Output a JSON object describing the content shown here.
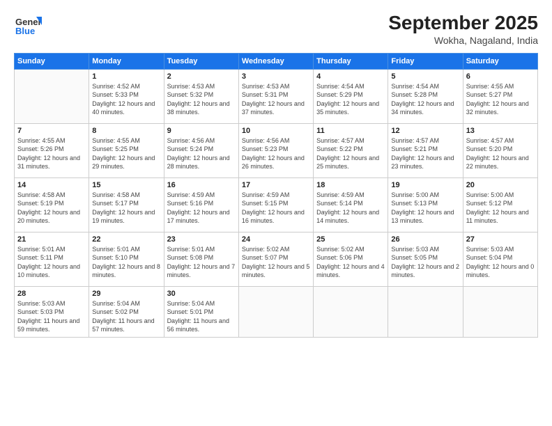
{
  "logo": {
    "line1": "General",
    "line2": "Blue"
  },
  "title": "September 2025",
  "subtitle": "Wokha, Nagaland, India",
  "headers": [
    "Sunday",
    "Monday",
    "Tuesday",
    "Wednesday",
    "Thursday",
    "Friday",
    "Saturday"
  ],
  "weeks": [
    [
      {
        "day": "",
        "sunrise": "",
        "sunset": "",
        "daylight": ""
      },
      {
        "day": "1",
        "sunrise": "Sunrise: 4:52 AM",
        "sunset": "Sunset: 5:33 PM",
        "daylight": "Daylight: 12 hours and 40 minutes."
      },
      {
        "day": "2",
        "sunrise": "Sunrise: 4:53 AM",
        "sunset": "Sunset: 5:32 PM",
        "daylight": "Daylight: 12 hours and 38 minutes."
      },
      {
        "day": "3",
        "sunrise": "Sunrise: 4:53 AM",
        "sunset": "Sunset: 5:31 PM",
        "daylight": "Daylight: 12 hours and 37 minutes."
      },
      {
        "day": "4",
        "sunrise": "Sunrise: 4:54 AM",
        "sunset": "Sunset: 5:29 PM",
        "daylight": "Daylight: 12 hours and 35 minutes."
      },
      {
        "day": "5",
        "sunrise": "Sunrise: 4:54 AM",
        "sunset": "Sunset: 5:28 PM",
        "daylight": "Daylight: 12 hours and 34 minutes."
      },
      {
        "day": "6",
        "sunrise": "Sunrise: 4:55 AM",
        "sunset": "Sunset: 5:27 PM",
        "daylight": "Daylight: 12 hours and 32 minutes."
      }
    ],
    [
      {
        "day": "7",
        "sunrise": "Sunrise: 4:55 AM",
        "sunset": "Sunset: 5:26 PM",
        "daylight": "Daylight: 12 hours and 31 minutes."
      },
      {
        "day": "8",
        "sunrise": "Sunrise: 4:55 AM",
        "sunset": "Sunset: 5:25 PM",
        "daylight": "Daylight: 12 hours and 29 minutes."
      },
      {
        "day": "9",
        "sunrise": "Sunrise: 4:56 AM",
        "sunset": "Sunset: 5:24 PM",
        "daylight": "Daylight: 12 hours and 28 minutes."
      },
      {
        "day": "10",
        "sunrise": "Sunrise: 4:56 AM",
        "sunset": "Sunset: 5:23 PM",
        "daylight": "Daylight: 12 hours and 26 minutes."
      },
      {
        "day": "11",
        "sunrise": "Sunrise: 4:57 AM",
        "sunset": "Sunset: 5:22 PM",
        "daylight": "Daylight: 12 hours and 25 minutes."
      },
      {
        "day": "12",
        "sunrise": "Sunrise: 4:57 AM",
        "sunset": "Sunset: 5:21 PM",
        "daylight": "Daylight: 12 hours and 23 minutes."
      },
      {
        "day": "13",
        "sunrise": "Sunrise: 4:57 AM",
        "sunset": "Sunset: 5:20 PM",
        "daylight": "Daylight: 12 hours and 22 minutes."
      }
    ],
    [
      {
        "day": "14",
        "sunrise": "Sunrise: 4:58 AM",
        "sunset": "Sunset: 5:19 PM",
        "daylight": "Daylight: 12 hours and 20 minutes."
      },
      {
        "day": "15",
        "sunrise": "Sunrise: 4:58 AM",
        "sunset": "Sunset: 5:17 PM",
        "daylight": "Daylight: 12 hours and 19 minutes."
      },
      {
        "day": "16",
        "sunrise": "Sunrise: 4:59 AM",
        "sunset": "Sunset: 5:16 PM",
        "daylight": "Daylight: 12 hours and 17 minutes."
      },
      {
        "day": "17",
        "sunrise": "Sunrise: 4:59 AM",
        "sunset": "Sunset: 5:15 PM",
        "daylight": "Daylight: 12 hours and 16 minutes."
      },
      {
        "day": "18",
        "sunrise": "Sunrise: 4:59 AM",
        "sunset": "Sunset: 5:14 PM",
        "daylight": "Daylight: 12 hours and 14 minutes."
      },
      {
        "day": "19",
        "sunrise": "Sunrise: 5:00 AM",
        "sunset": "Sunset: 5:13 PM",
        "daylight": "Daylight: 12 hours and 13 minutes."
      },
      {
        "day": "20",
        "sunrise": "Sunrise: 5:00 AM",
        "sunset": "Sunset: 5:12 PM",
        "daylight": "Daylight: 12 hours and 11 minutes."
      }
    ],
    [
      {
        "day": "21",
        "sunrise": "Sunrise: 5:01 AM",
        "sunset": "Sunset: 5:11 PM",
        "daylight": "Daylight: 12 hours and 10 minutes."
      },
      {
        "day": "22",
        "sunrise": "Sunrise: 5:01 AM",
        "sunset": "Sunset: 5:10 PM",
        "daylight": "Daylight: 12 hours and 8 minutes."
      },
      {
        "day": "23",
        "sunrise": "Sunrise: 5:01 AM",
        "sunset": "Sunset: 5:08 PM",
        "daylight": "Daylight: 12 hours and 7 minutes."
      },
      {
        "day": "24",
        "sunrise": "Sunrise: 5:02 AM",
        "sunset": "Sunset: 5:07 PM",
        "daylight": "Daylight: 12 hours and 5 minutes."
      },
      {
        "day": "25",
        "sunrise": "Sunrise: 5:02 AM",
        "sunset": "Sunset: 5:06 PM",
        "daylight": "Daylight: 12 hours and 4 minutes."
      },
      {
        "day": "26",
        "sunrise": "Sunrise: 5:03 AM",
        "sunset": "Sunset: 5:05 PM",
        "daylight": "Daylight: 12 hours and 2 minutes."
      },
      {
        "day": "27",
        "sunrise": "Sunrise: 5:03 AM",
        "sunset": "Sunset: 5:04 PM",
        "daylight": "Daylight: 12 hours and 0 minutes."
      }
    ],
    [
      {
        "day": "28",
        "sunrise": "Sunrise: 5:03 AM",
        "sunset": "Sunset: 5:03 PM",
        "daylight": "Daylight: 11 hours and 59 minutes."
      },
      {
        "day": "29",
        "sunrise": "Sunrise: 5:04 AM",
        "sunset": "Sunset: 5:02 PM",
        "daylight": "Daylight: 11 hours and 57 minutes."
      },
      {
        "day": "30",
        "sunrise": "Sunrise: 5:04 AM",
        "sunset": "Sunset: 5:01 PM",
        "daylight": "Daylight: 11 hours and 56 minutes."
      },
      {
        "day": "",
        "sunrise": "",
        "sunset": "",
        "daylight": ""
      },
      {
        "day": "",
        "sunrise": "",
        "sunset": "",
        "daylight": ""
      },
      {
        "day": "",
        "sunrise": "",
        "sunset": "",
        "daylight": ""
      },
      {
        "day": "",
        "sunrise": "",
        "sunset": "",
        "daylight": ""
      }
    ]
  ]
}
